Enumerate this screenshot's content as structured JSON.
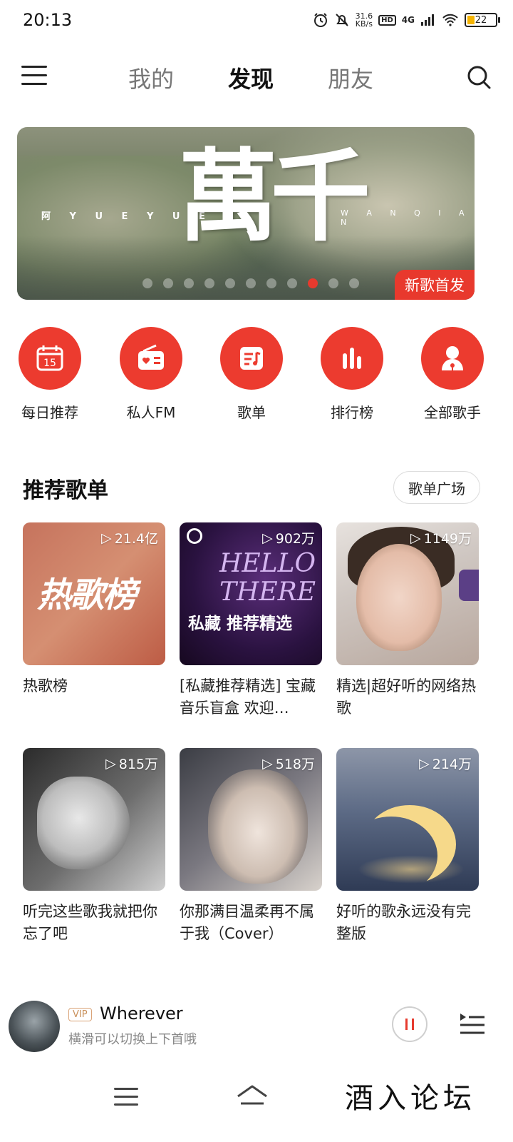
{
  "status_bar": {
    "time": "20:13",
    "net_speed": "31.6",
    "net_unit": "KB/s",
    "hd": "HD",
    "network": "4G",
    "battery": "22"
  },
  "nav": {
    "tabs": [
      {
        "label": "我的",
        "active": false
      },
      {
        "label": "发现",
        "active": true
      },
      {
        "label": "朋友",
        "active": false
      }
    ]
  },
  "banner": {
    "title": "萬千",
    "left_text": "阿 Y U E Y U E",
    "right_text": "W A N Q I A N",
    "badge": "新歌首发",
    "dot_count": 11,
    "active_dot": 8
  },
  "quick_entries": [
    {
      "label": "每日推荐",
      "icon": "calendar-icon",
      "icon_text": "15"
    },
    {
      "label": "私人FM",
      "icon": "radio-icon"
    },
    {
      "label": "歌单",
      "icon": "playlist-icon"
    },
    {
      "label": "排行榜",
      "icon": "chart-bars-icon"
    },
    {
      "label": "全部歌手",
      "icon": "singer-icon"
    }
  ],
  "recommend": {
    "title": "推荐歌单",
    "more": "歌单广场",
    "playlists": [
      {
        "title": "热歌榜",
        "plays": "21.4亿",
        "cover_text": "热歌榜"
      },
      {
        "title": "[私藏推荐精选] 宝藏音乐盲盒 欢迎…",
        "plays": "902万",
        "cover_text": "HELLO THERE",
        "cover_sub": "私藏 推荐精选"
      },
      {
        "title": "精选|超好听的网络热歌",
        "plays": "1149万"
      },
      {
        "title": "听完这些歌我就把你忘了吧",
        "plays": "815万"
      },
      {
        "title": "你那满目温柔再不属于我（Cover）",
        "plays": "518万"
      },
      {
        "title": "好听的歌永远没有完整版",
        "plays": "214万"
      }
    ]
  },
  "player": {
    "vip": "VIP",
    "song": "Wherever",
    "hint": "横滑可以切换上下首哦"
  },
  "watermark": "酒入论坛",
  "colors": {
    "accent": "#e63a2e",
    "text": "#222222",
    "muted": "#888888"
  }
}
